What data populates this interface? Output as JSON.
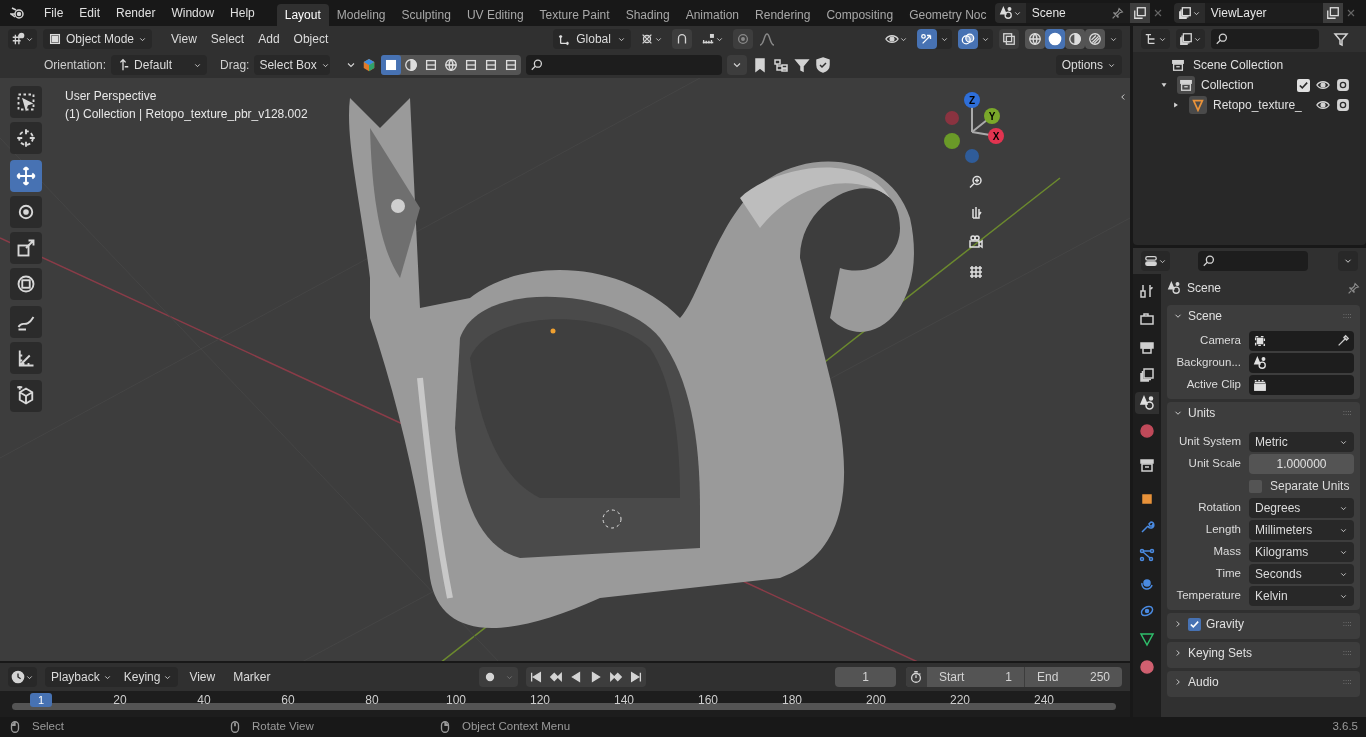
{
  "menu": [
    "File",
    "Edit",
    "Render",
    "Window",
    "Help"
  ],
  "workspaces": [
    {
      "label": "Layout",
      "selected": true
    },
    {
      "label": "Modeling",
      "selected": false
    },
    {
      "label": "Sculpting",
      "selected": false
    },
    {
      "label": "UV Editing",
      "selected": false
    },
    {
      "label": "Texture Paint",
      "selected": false
    },
    {
      "label": "Shading",
      "selected": false
    },
    {
      "label": "Animation",
      "selected": false
    },
    {
      "label": "Rendering",
      "selected": false
    },
    {
      "label": "Compositing",
      "selected": false
    },
    {
      "label": "Geometry Noc",
      "selected": false
    }
  ],
  "scene_selector": {
    "value": "Scene"
  },
  "view_layer_selector": {
    "value": "ViewLayer"
  },
  "viewport_header": {
    "mode": "Object Mode",
    "menus": [
      "View",
      "Select",
      "Add",
      "Object"
    ],
    "transform_orientation": "Global",
    "gizmos_on": true,
    "overlays_on": true,
    "shading": [
      {
        "kind": "wireframe",
        "selected": false
      },
      {
        "kind": "solid",
        "selected": true
      },
      {
        "kind": "material",
        "selected": false
      },
      {
        "kind": "rendered",
        "selected": false
      }
    ]
  },
  "tool_settings": {
    "orientation_label": "Orientation:",
    "orientation": "Default",
    "drag_label": "Drag:",
    "drag": "Select Box",
    "options": "Options"
  },
  "viewport": {
    "view_name": "User Perspective",
    "object_info": "(1) Collection | Retopo_texture_pbr_v128.002",
    "tools": [
      {
        "kind": "select",
        "selected": false
      },
      {
        "kind": "cursor",
        "selected": false
      },
      {
        "kind": "move",
        "selected": true
      },
      {
        "kind": "rotate",
        "selected": false
      },
      {
        "kind": "scale",
        "selected": false
      },
      {
        "kind": "transform",
        "selected": false
      },
      {
        "kind": "annotate",
        "selected": false
      },
      {
        "kind": "measure",
        "selected": false
      },
      {
        "kind": "add-cube",
        "selected": false
      }
    ],
    "gizmo_axes": [
      "Z",
      "Y",
      "X"
    ]
  },
  "outliner": {
    "tree": [
      {
        "label": "Scene Collection",
        "kind": "scene",
        "children": [
          {
            "label": "Collection",
            "kind": "collection",
            "expanded": true,
            "checked": true,
            "children": [
              {
                "label": "Retopo_texture_",
                "kind": "mesh",
                "expanded": false
              }
            ]
          }
        ]
      }
    ]
  },
  "properties": {
    "tabs": [
      {
        "kind": "tool",
        "selected": false
      },
      {
        "kind": "render",
        "selected": false
      },
      {
        "kind": "output",
        "selected": false
      },
      {
        "kind": "view-layer",
        "selected": false
      },
      {
        "kind": "scene",
        "selected": true
      },
      {
        "kind": "world",
        "selected": false
      },
      {
        "kind": "collection",
        "selected": false
      },
      {
        "kind": "object",
        "selected": false
      },
      {
        "kind": "modifier",
        "selected": false
      },
      {
        "kind": "particles",
        "selected": false
      },
      {
        "kind": "physics",
        "selected": false
      },
      {
        "kind": "constraints",
        "selected": false
      },
      {
        "kind": "data",
        "selected": false
      },
      {
        "kind": "material",
        "selected": false
      }
    ],
    "title": "Scene",
    "panels": [
      {
        "title": "Scene",
        "expanded": true,
        "fields": [
          {
            "kind": "object",
            "label": "Camera"
          },
          {
            "kind": "scene",
            "label": "Backgroun..."
          },
          {
            "kind": "clip",
            "label": "Active Clip"
          }
        ]
      },
      {
        "title": "Units",
        "expanded": true,
        "fields": [
          {
            "kind": "dropdown",
            "label": "Unit System",
            "value": "Metric"
          },
          {
            "kind": "number",
            "label": "Unit Scale",
            "value": "1.000000"
          },
          {
            "kind": "checkbox",
            "label": "Separate Units",
            "checked": false
          },
          {
            "kind": "dropdown",
            "label": "Rotation",
            "value": "Degrees"
          },
          {
            "kind": "dropdown",
            "label": "Length",
            "value": "Millimeters"
          },
          {
            "kind": "dropdown",
            "label": "Mass",
            "value": "Kilograms"
          },
          {
            "kind": "dropdown",
            "label": "Time",
            "value": "Seconds"
          },
          {
            "kind": "dropdown",
            "label": "Temperature",
            "value": "Kelvin"
          }
        ]
      },
      {
        "title": "Gravity",
        "expanded": false,
        "checked": true
      },
      {
        "title": "Keying Sets",
        "expanded": false
      },
      {
        "title": "Audio",
        "expanded": false
      }
    ]
  },
  "timeline": {
    "menus": [
      "Playback",
      "Keying",
      "View",
      "Marker"
    ],
    "current_frame": "1",
    "start_label": "Start",
    "start": "1",
    "end_label": "End",
    "end": "250",
    "ruler": [
      "1",
      "20",
      "40",
      "60",
      "80",
      "100",
      "120",
      "140",
      "160",
      "180",
      "200",
      "220",
      "240"
    ]
  },
  "status_bar": {
    "items": [
      {
        "kind": "left-click",
        "label": "Select"
      },
      {
        "kind": "middle-click",
        "label": "Rotate View"
      },
      {
        "kind": "right-click",
        "label": "Object Context Menu"
      }
    ],
    "version": "3.6.5"
  }
}
